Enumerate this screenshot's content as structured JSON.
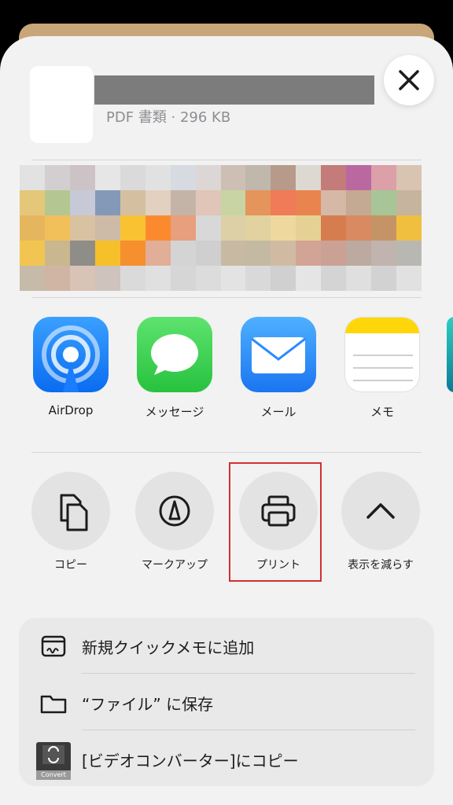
{
  "header": {
    "file_subtitle": "PDF 書類 · 296 KB",
    "close_icon": "close-icon"
  },
  "apps": [
    {
      "label": "AirDrop",
      "icon": "airdrop-icon",
      "color": "#1e88ff"
    },
    {
      "label": "メッセージ",
      "icon": "messages-icon",
      "color": "#34c759"
    },
    {
      "label": "メール",
      "icon": "mail-icon",
      "color": "#2a8cff"
    },
    {
      "label": "メモ",
      "icon": "notes-icon",
      "color": "#ffd60a"
    }
  ],
  "actions": [
    {
      "label": "コピー",
      "icon": "copy-icon"
    },
    {
      "label": "マークアップ",
      "icon": "markup-icon"
    },
    {
      "label": "プリント",
      "icon": "printer-icon"
    },
    {
      "label": "表示を減らす",
      "icon": "chevron-up-icon"
    }
  ],
  "list": [
    {
      "label": "新規クイックメモに追加",
      "icon": "quick-note-icon"
    },
    {
      "label": "“ファイル” に保存",
      "icon": "folder-icon"
    },
    {
      "label": "[ビデオコンバーター]にコピー",
      "icon": "video-converter-icon",
      "icon_caption": "Convert"
    }
  ],
  "colors": {
    "highlight": "#d32f2f",
    "sheet_bg": "#f2f2f2"
  }
}
